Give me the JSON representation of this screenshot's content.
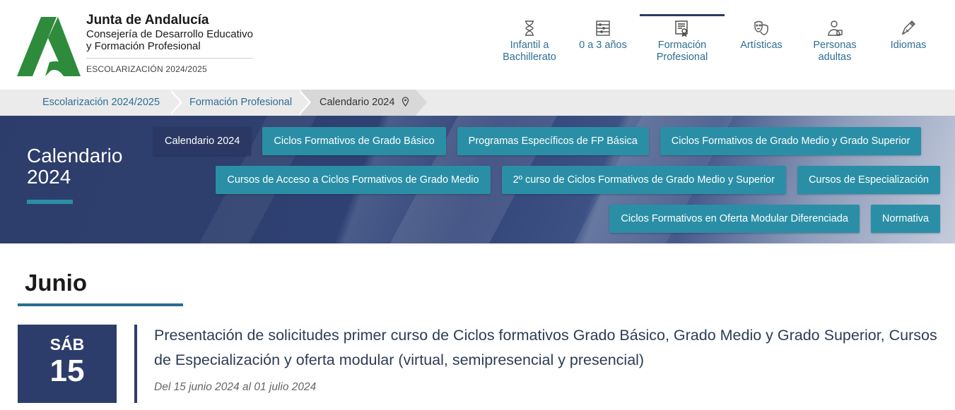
{
  "brand": {
    "name": "Junta de Andalucía",
    "department_line1": "Consejería de Desarrollo Educativo",
    "department_line2": "y Formación Profesional",
    "subtitle": "ESCOLARIZACIÓN 2024/2025",
    "logo_color": "#2e8b3c"
  },
  "topnav": [
    {
      "label_line1": "Infantil a",
      "label_line2": "Bachillerato",
      "icon": "hourglass-icon"
    },
    {
      "label_line1": "0 a 3 años",
      "label_line2": "",
      "icon": "abacus-icon"
    },
    {
      "label_line1": "Formación",
      "label_line2": "Profesional",
      "icon": "certificate-icon",
      "active": true
    },
    {
      "label_line1": "Artísticas",
      "label_line2": "",
      "icon": "theater-masks-icon"
    },
    {
      "label_line1": "Personas",
      "label_line2": "adultas",
      "icon": "adult-person-icon"
    },
    {
      "label_line1": "Idiomas",
      "label_line2": "",
      "icon": "pen-icon"
    }
  ],
  "breadcrumb": [
    {
      "label": "Escolarización 2024/2025"
    },
    {
      "label": "Formación Profesional"
    },
    {
      "label": "Calendario 2024",
      "current": true
    }
  ],
  "banner": {
    "title": "Calendario 2024"
  },
  "subnav": {
    "row1": [
      "Calendario 2024",
      "Ciclos Formativos de Grado Básico",
      "Programas Específicos de FP Básica",
      "Ciclos Formativos de Grado Medio y Grado Superior"
    ],
    "row2": [
      "Cursos de Acceso a Ciclos Formativos de Grado Medio",
      "2º curso de Ciclos Formativos de Grado Medio y Superior",
      "Cursos de Especialización"
    ],
    "row3": [
      "Ciclos Formativos en Oferta Modular Diferenciada",
      "Normativa"
    ]
  },
  "content": {
    "month": "Junio",
    "event": {
      "day_of_week": "SÁB",
      "day": "15",
      "title": "Presentación de solicitudes primer curso de Ciclos formativos Grado Básico, Grado Medio y Grado Superior, Cursos de Especialización y oferta modular (virtual, semipresencial y presencial)",
      "dates": "Del 15 junio 2024 al 01 julio 2024"
    }
  },
  "colors": {
    "navy": "#2d3d6b",
    "teal": "#2a8fa6",
    "link": "#2e6f93"
  }
}
